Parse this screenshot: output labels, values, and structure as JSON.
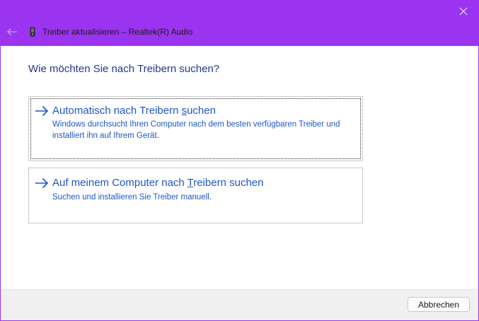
{
  "window": {
    "title": "Treiber aktualisieren – Realtek(R) Audio",
    "icons": {
      "close": "close-icon",
      "back": "back-arrow-icon",
      "device": "device-icon"
    },
    "colors": {
      "titlebar": "#9b34f0",
      "link": "#1f56c7",
      "heading": "#1f3a8a"
    }
  },
  "main": {
    "heading": "Wie möchten Sie nach Treibern suchen?",
    "options": [
      {
        "title_before": "Automatisch nach Treibern ",
        "title_accel": "s",
        "title_after": "uchen",
        "description": "Windows durchsucht Ihren Computer nach dem besten verfügbaren Treiber und installiert ihn auf Ihrem Gerät.",
        "icon": "arrow-right-icon"
      },
      {
        "title_before": "Auf meinem Computer nach ",
        "title_accel": "T",
        "title_after": "reibern suchen",
        "description": "Suchen und installieren Sie Treiber manuell.",
        "icon": "arrow-right-icon"
      }
    ]
  },
  "footer": {
    "cancel_label": "Abbrechen"
  }
}
